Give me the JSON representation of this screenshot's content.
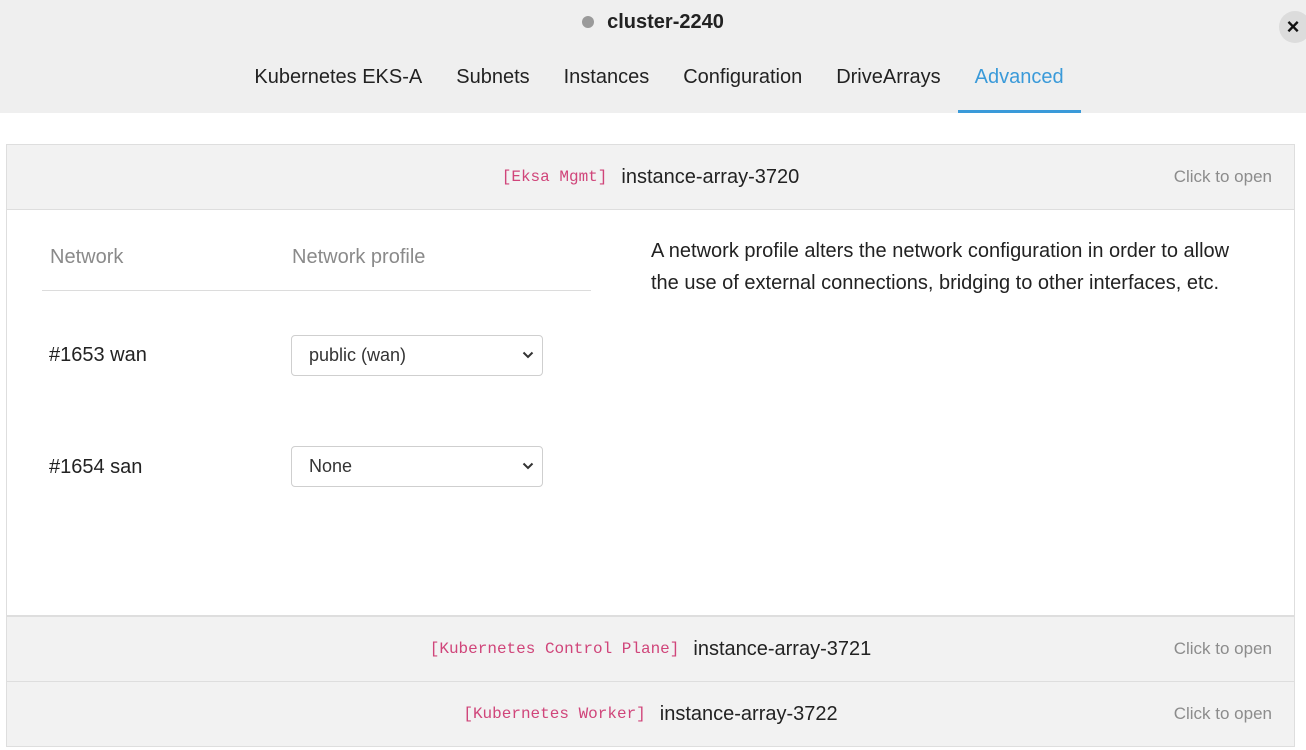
{
  "header": {
    "cluster_name": "cluster-2240",
    "close_label": "×"
  },
  "tabs": [
    {
      "label": "Kubernetes EKS-A",
      "active": false
    },
    {
      "label": "Subnets",
      "active": false
    },
    {
      "label": "Instances",
      "active": false
    },
    {
      "label": "Configuration",
      "active": false
    },
    {
      "label": "DriveArrays",
      "active": false
    },
    {
      "label": "Advanced",
      "active": true
    }
  ],
  "arrays": [
    {
      "tag": "[Eksa Mgmt]",
      "name": "instance-array-3720",
      "action": "Click to open",
      "expanded": true
    },
    {
      "tag": "[Kubernetes Control Plane]",
      "name": "instance-array-3721",
      "action": "Click to open",
      "expanded": false
    },
    {
      "tag": "[Kubernetes Worker]",
      "name": "instance-array-3722",
      "action": "Click to open",
      "expanded": false
    }
  ],
  "network_table": {
    "headers": {
      "network": "Network",
      "profile": "Network profile"
    },
    "rows": [
      {
        "network": "#1653 wan",
        "profile": "public (wan)"
      },
      {
        "network": "#1654 san",
        "profile": "None"
      }
    ]
  },
  "description": "A network profile alters the network configuration in order to allow the use of external connections, bridging to other interfaces, etc.",
  "colors": {
    "accent": "#3a9ad9",
    "tag": "#d0457a",
    "status_dot": "#9a9a9a"
  }
}
